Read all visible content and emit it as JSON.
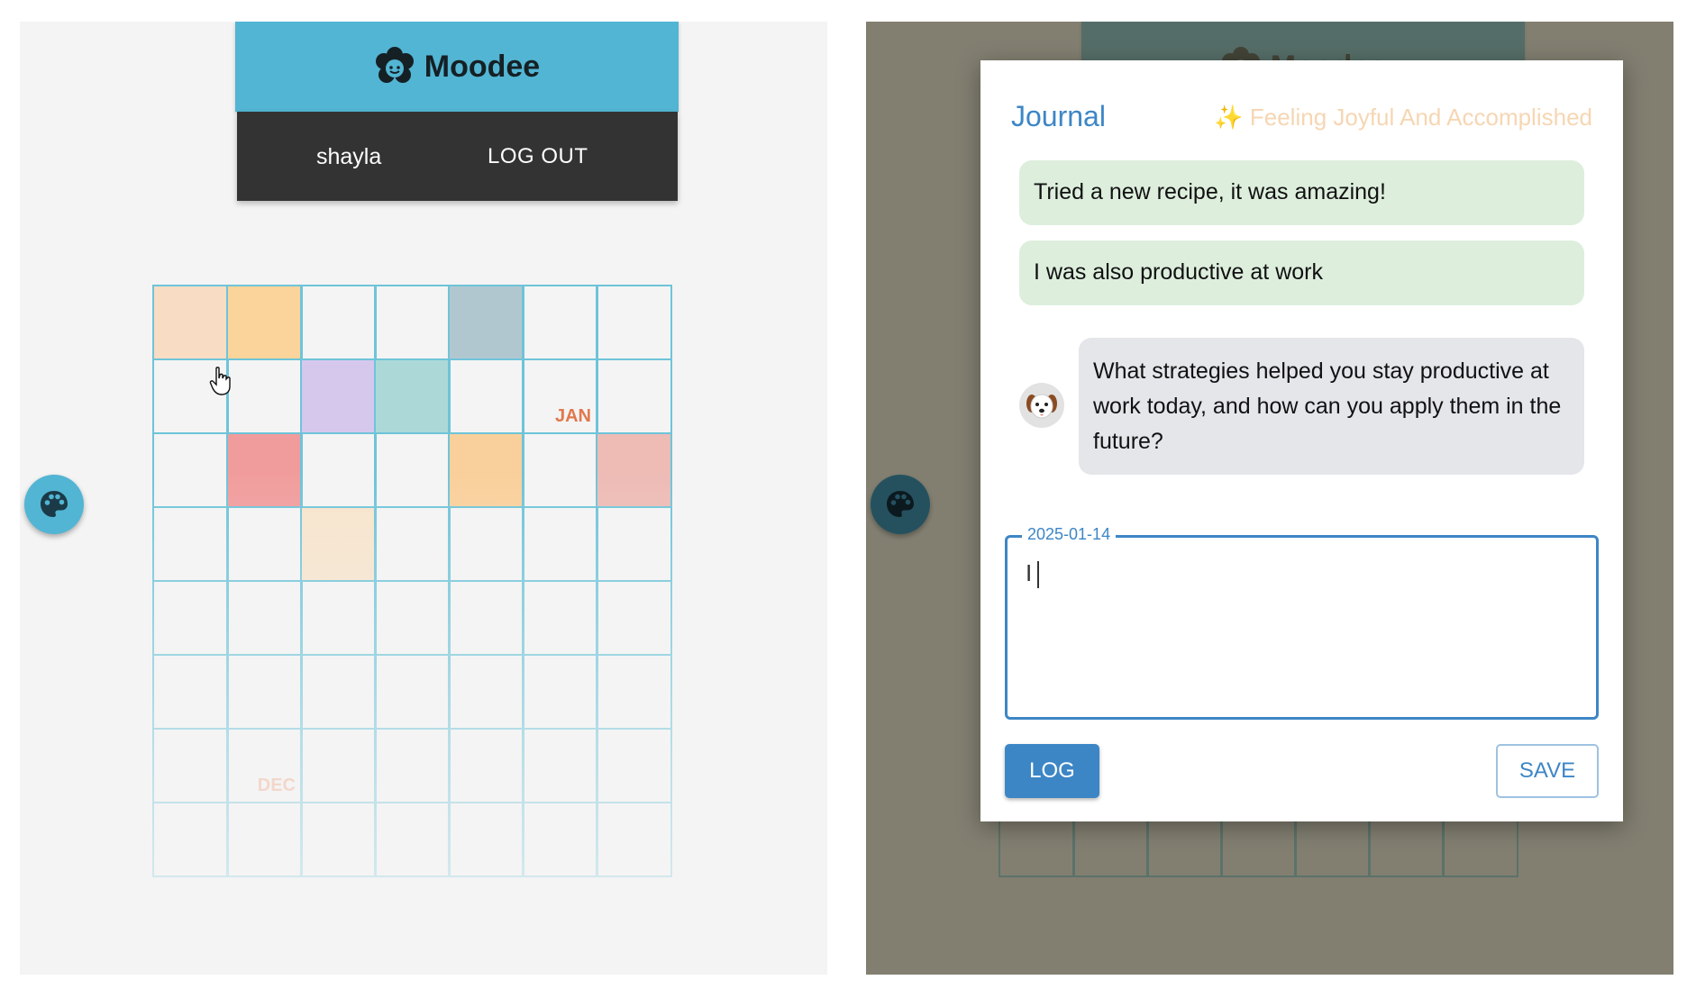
{
  "app": {
    "title": "Moodee",
    "username": "shayla",
    "logout_label": "LOG OUT"
  },
  "colors": {
    "header": "#52b5d3",
    "userbar": "#333333",
    "cell_border": "#6ec4d9",
    "accent_blue": "#3d86c6",
    "entry_bubble": "#ddeedd",
    "ai_bubble": "#e4e6ea"
  },
  "grid": {
    "columns": 7,
    "rows": [
      [
        "#f9dcc4",
        "#fad49a",
        "",
        "",
        "#b1c7d0",
        "",
        ""
      ],
      [
        "",
        "",
        "#d6c8ed",
        "#acd9d8",
        "",
        "",
        ""
      ],
      [
        "",
        "#f19c9c",
        "",
        "",
        "#f9d09b",
        "",
        "#eebbb5"
      ],
      [
        "",
        "",
        "#f7e4cc",
        "",
        "",
        "",
        ""
      ],
      [
        "",
        "",
        "",
        "",
        "",
        "",
        ""
      ],
      [
        "",
        "",
        "",
        "",
        "",
        "",
        ""
      ],
      [
        "",
        "",
        "",
        "",
        "",
        "",
        ""
      ],
      [
        "",
        "",
        "",
        "",
        "",
        "",
        ""
      ]
    ],
    "month_labels": [
      {
        "text": "JAN",
        "row": 1,
        "col": 5,
        "color": "#e0794d"
      },
      {
        "text": "DEC",
        "row": 6,
        "col": 1,
        "color": "#f2a98c"
      }
    ]
  },
  "icons": {
    "logo": "flower-face-icon",
    "palette": "palette-icon",
    "cursor": "hand-pointer-icon",
    "avatar": "dog-face-icon"
  },
  "modal": {
    "title": "Journal",
    "mood": "✨ Feeling Joyful And Accomplished",
    "entries": [
      "Tried a new recipe, it was amazing!",
      "I was also productive at work"
    ],
    "ai_question": "What strategies helped you stay productive at work today, and how can you apply them in the future?",
    "input_label": "2025-01-14",
    "input_value": "I",
    "log_label": "LOG",
    "save_label": "SAVE"
  }
}
